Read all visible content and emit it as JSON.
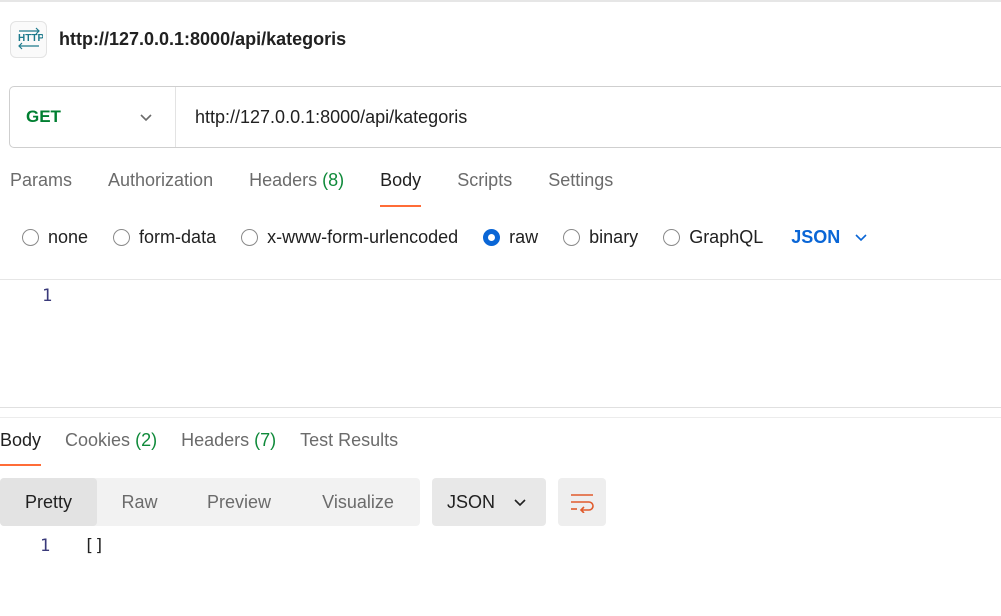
{
  "request": {
    "title": "http://127.0.0.1:8000/api/kategoris",
    "method": "GET",
    "url": "http://127.0.0.1:8000/api/kategoris"
  },
  "request_tabs": [
    {
      "label": "Params",
      "count": ""
    },
    {
      "label": "Authorization",
      "count": ""
    },
    {
      "label": "Headers",
      "count": "(8)"
    },
    {
      "label": "Body",
      "count": ""
    },
    {
      "label": "Scripts",
      "count": ""
    },
    {
      "label": "Settings",
      "count": ""
    }
  ],
  "active_request_tab": "Body",
  "body_types": {
    "options": [
      "none",
      "form-data",
      "x-www-form-urlencoded",
      "raw",
      "binary",
      "GraphQL"
    ],
    "selected": "raw",
    "language": "JSON"
  },
  "editor": {
    "line_number": "1",
    "content": ""
  },
  "response_tabs": [
    {
      "label": "Body",
      "count": ""
    },
    {
      "label": "Cookies",
      "count": "(2)"
    },
    {
      "label": "Headers",
      "count": "(7)"
    },
    {
      "label": "Test Results",
      "count": ""
    }
  ],
  "active_response_tab": "Body",
  "response_view": {
    "modes": [
      "Pretty",
      "Raw",
      "Preview",
      "Visualize"
    ],
    "selected": "Pretty",
    "language": "JSON"
  },
  "response_body": {
    "line_number": "1",
    "content": "[]"
  },
  "icons": {
    "request_type": "http-icon",
    "method_dropdown": "chevron-down-icon",
    "language_dropdown": "chevron-down-icon",
    "wrap": "wrap-lines-icon"
  },
  "colors": {
    "accent": "#ff6c37",
    "method_get": "#007f31",
    "link_blue": "#0a66d6",
    "count_green": "#0f8a3a"
  }
}
